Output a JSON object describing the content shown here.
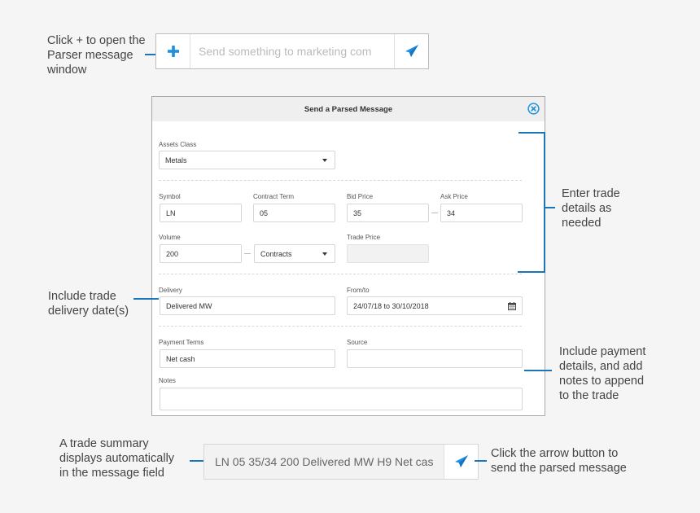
{
  "callouts": {
    "open_parser": [
      "Click + to open the",
      "Parser message",
      "window"
    ],
    "trade_details": [
      "Enter trade",
      "details as",
      "needed"
    ],
    "delivery": [
      "Include trade",
      "delivery date(s)"
    ],
    "payment": [
      "Include payment",
      "details, and add",
      "notes to append",
      "to the trade"
    ],
    "summary": [
      "A trade summary",
      "displays automatically",
      "in the message field"
    ],
    "send": [
      "Click the arrow button to",
      "send the parsed message"
    ]
  },
  "top_bar": {
    "add_icon": "plus-icon",
    "placeholder": "Send something to marketing com",
    "send_icon": "paper-plane-icon"
  },
  "dialog": {
    "title": "Send a Parsed Message",
    "close_icon": "close-circle-icon",
    "assets_class": {
      "label": "Assets Class",
      "value": "Metals"
    },
    "symbol": {
      "label": "Symbol",
      "value": "LN"
    },
    "contract_term": {
      "label": "Contract Term",
      "value": "05"
    },
    "bid_price": {
      "label": "Bid Price",
      "value": "35"
    },
    "ask_price": {
      "label": "Ask Price",
      "value": "34"
    },
    "volume": {
      "label": "Volume",
      "value": "200"
    },
    "volume_unit": {
      "value": "Contracts"
    },
    "trade_price": {
      "label": "Trade Price",
      "value": ""
    },
    "delivery": {
      "label": "Delivery",
      "value": "Delivered MW"
    },
    "from_to": {
      "label": "From/to",
      "value": "24/07/18 to 30/10/2018",
      "icon": "calendar-icon"
    },
    "payment_terms": {
      "label": "Payment Terms",
      "value": "Net cash"
    },
    "source": {
      "label": "Source",
      "value": ""
    },
    "notes": {
      "label": "Notes",
      "value": ""
    }
  },
  "bottom_bar": {
    "message": "LN 05 35/34 200 Delivered MW H9 Net cas",
    "send_icon": "paper-plane-icon"
  },
  "colors": {
    "accent": "#1a75bb",
    "icon_blue": "#1e8fe1"
  }
}
